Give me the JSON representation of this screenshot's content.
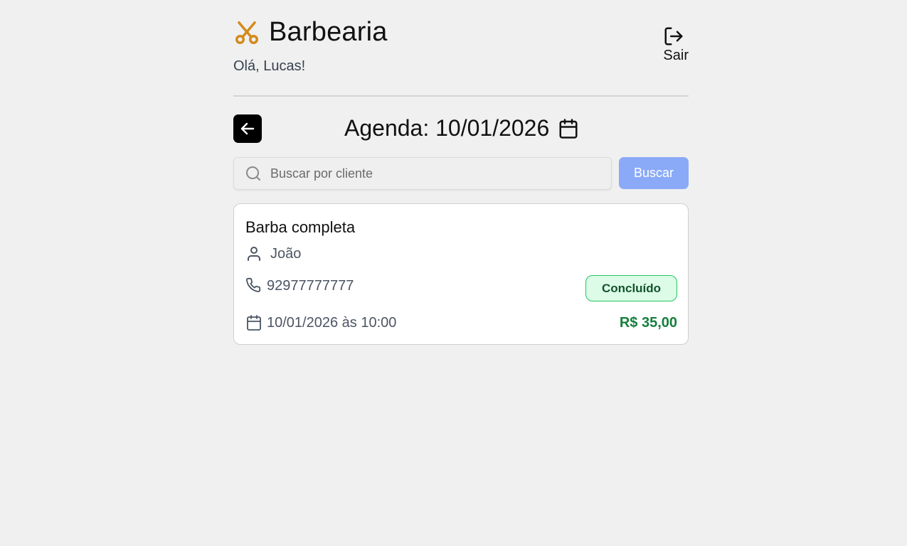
{
  "header": {
    "title": "Barbearia",
    "greeting": "Olá, Lucas!",
    "logout_label": "Sair",
    "brand_icon": "scissors-icon",
    "brand_color": "#d48a1a"
  },
  "agenda": {
    "title": "Agenda: 10/01/2026"
  },
  "search": {
    "placeholder": "Buscar por cliente",
    "value": "",
    "button_label": "Buscar",
    "button_color": "#8aaaf8"
  },
  "appointments": [
    {
      "service": "Barba completa",
      "client": "João",
      "phone": "92977777777",
      "datetime": "10/01/2026 às 10:00",
      "status": "Concluído",
      "price": "R$ 35,00",
      "status_color": "#22c55e",
      "price_color": "#15803d"
    }
  ]
}
